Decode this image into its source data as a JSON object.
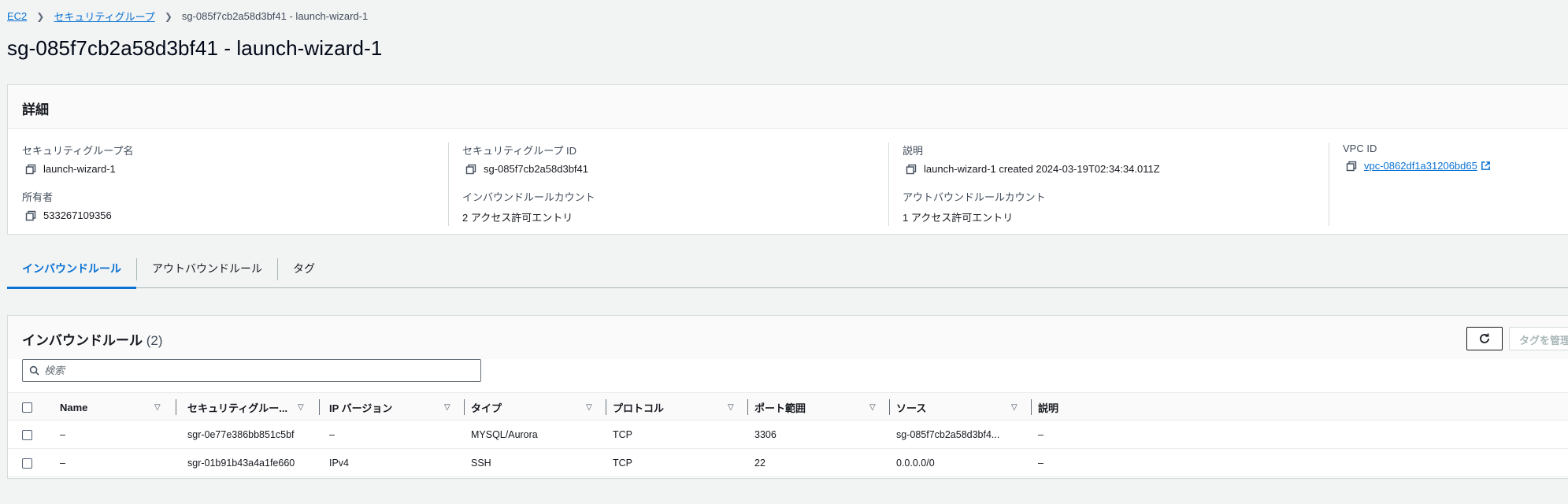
{
  "breadcrumb": {
    "items": [
      "EC2",
      "セキュリティグループ"
    ],
    "current": "sg-085f7cb2a58d3bf41 - launch-wizard-1"
  },
  "page_title": "sg-085f7cb2a58d3bf41 - launch-wizard-1",
  "details": {
    "title": "詳細",
    "sg_name_label": "セキュリティグループ名",
    "sg_name": "launch-wizard-1",
    "sg_id_label": "セキュリティグループ ID",
    "sg_id": "sg-085f7cb2a58d3bf41",
    "description_label": "説明",
    "description": "launch-wizard-1 created 2024-03-19T02:34:34.011Z",
    "vpc_label": "VPC ID",
    "vpc_id": "vpc-0862df1a31206bd65",
    "owner_label": "所有者",
    "owner": "533267109356",
    "inbound_count_label": "インバウンドルールカウント",
    "inbound_count": "2 アクセス許可エントリ",
    "outbound_count_label": "アウトバウンドルールカウント",
    "outbound_count": "1 アクセス許可エントリ"
  },
  "tabs": [
    "インバウンドルール",
    "アウトバウンドルール",
    "タグ"
  ],
  "rules": {
    "title": "インバウンドルール",
    "count": "(2)",
    "search_placeholder": "検索",
    "manage_tags_label": "タグを管理",
    "columns": [
      "Name",
      "セキュリティグルー...",
      "IP バージョン",
      "タイプ",
      "プロトコル",
      "ポート範囲",
      "ソース",
      "説明"
    ],
    "rows": [
      [
        "–",
        "sgr-0e77e386bb851c5bf",
        "–",
        "MYSQL/Aurora",
        "TCP",
        "3306",
        "sg-085f7cb2a58d3bf4...",
        "–"
      ],
      [
        "–",
        "sgr-01b91b43a4a1fe660",
        "IPv4",
        "SSH",
        "TCP",
        "22",
        "0.0.0.0/0",
        "–"
      ]
    ]
  },
  "colors": {
    "link": "#0972d3",
    "background": "#f2f3f3",
    "panel": "#ffffff"
  }
}
